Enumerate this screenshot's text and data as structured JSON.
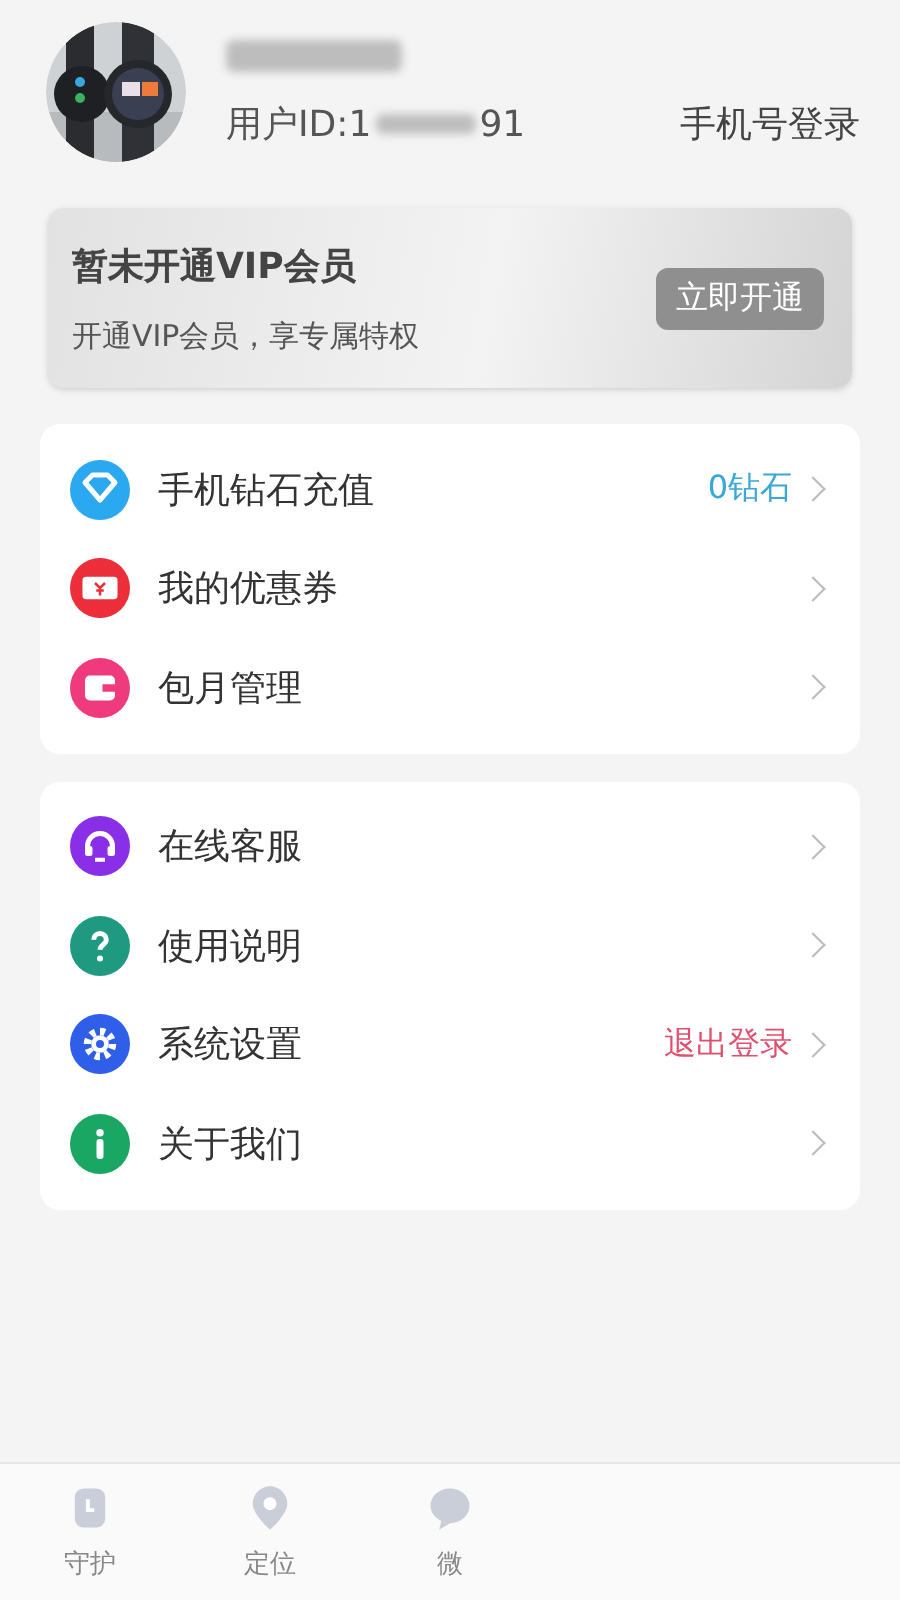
{
  "profile": {
    "user_id_prefix": "用户ID:1",
    "user_id_suffix": "91",
    "login_link": "手机号登录"
  },
  "vip_card": {
    "title": "暂未开通VIP会员",
    "subtitle": "开通VIP会员，享专属特权",
    "button": "立即开通"
  },
  "menu_groups": [
    {
      "items": [
        {
          "kind": "diamond",
          "color": "#2aa8f0",
          "label": "手机钻石充值",
          "value": {
            "text": "0钻石",
            "color": "#3ba7d8"
          }
        },
        {
          "kind": "coupon",
          "color": "#ec2d3a",
          "label": "我的优惠券"
        },
        {
          "kind": "wallet",
          "color": "#ef3a7e",
          "label": "包月管理"
        }
      ]
    },
    {
      "items": [
        {
          "kind": "headset",
          "color": "#8a2fe8",
          "label": "在线客服"
        },
        {
          "kind": "question",
          "color": "#1f9a80",
          "label": "使用说明"
        },
        {
          "kind": "gear",
          "color": "#2f5fe8",
          "label": "系统设置",
          "value": {
            "text": "退出登录",
            "color": "#e0506e"
          }
        },
        {
          "kind": "info",
          "color": "#1aa663",
          "label": "关于我们"
        }
      ]
    }
  ],
  "tab_bar": [
    {
      "kind": "watch",
      "label": "守护",
      "selected": false
    },
    {
      "kind": "pin",
      "label": "定位",
      "selected": false
    },
    {
      "kind": "chat",
      "label": "微",
      "selected": false
    }
  ]
}
